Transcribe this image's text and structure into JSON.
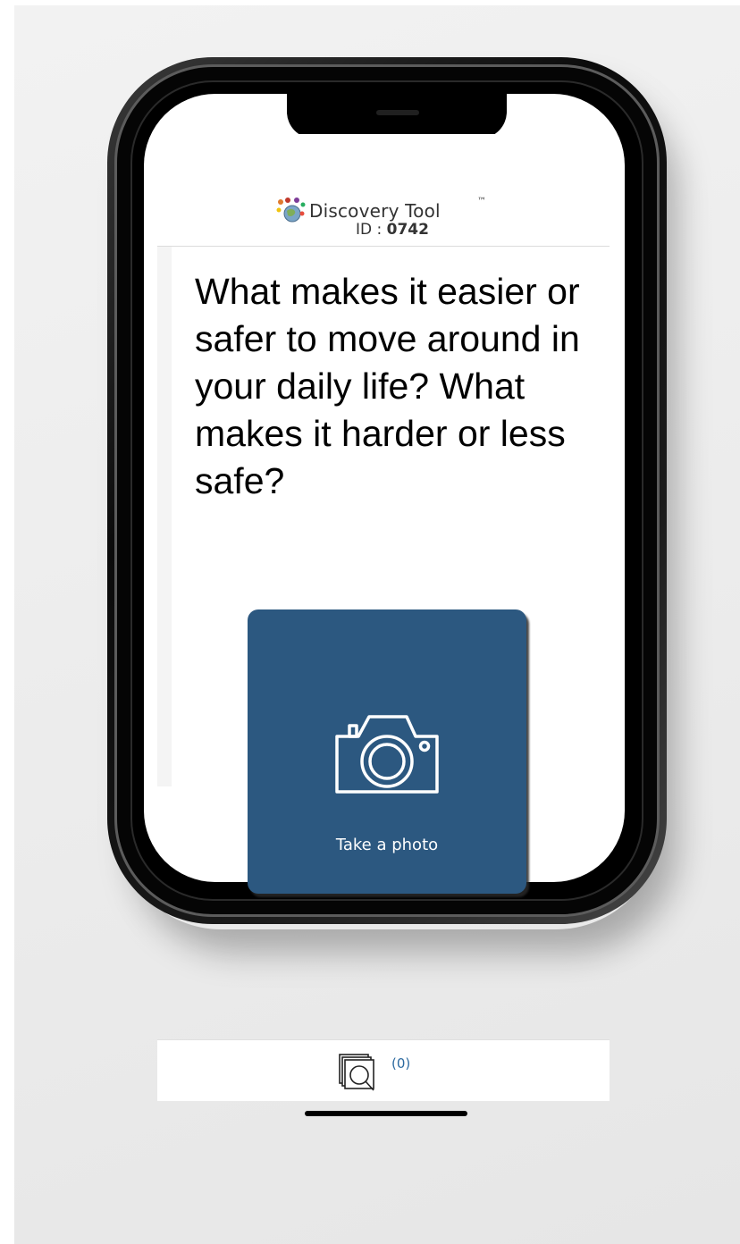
{
  "header": {
    "brand_name": "Discovery Tool",
    "trademark": "™",
    "id_label": "ID : ",
    "id_value": "0742"
  },
  "question": {
    "text": "What makes it easier or safer to move around in your daily life? What makes it harder or less safe?"
  },
  "photo_button": {
    "label": "Take a photo",
    "icon": "camera-icon",
    "color": "#2c5880"
  },
  "bottom_bar": {
    "gallery_icon": "photo-gallery-icon",
    "count_text": "(0)"
  },
  "colors": {
    "accent": "#2c5880",
    "link": "#2c6aa0"
  }
}
